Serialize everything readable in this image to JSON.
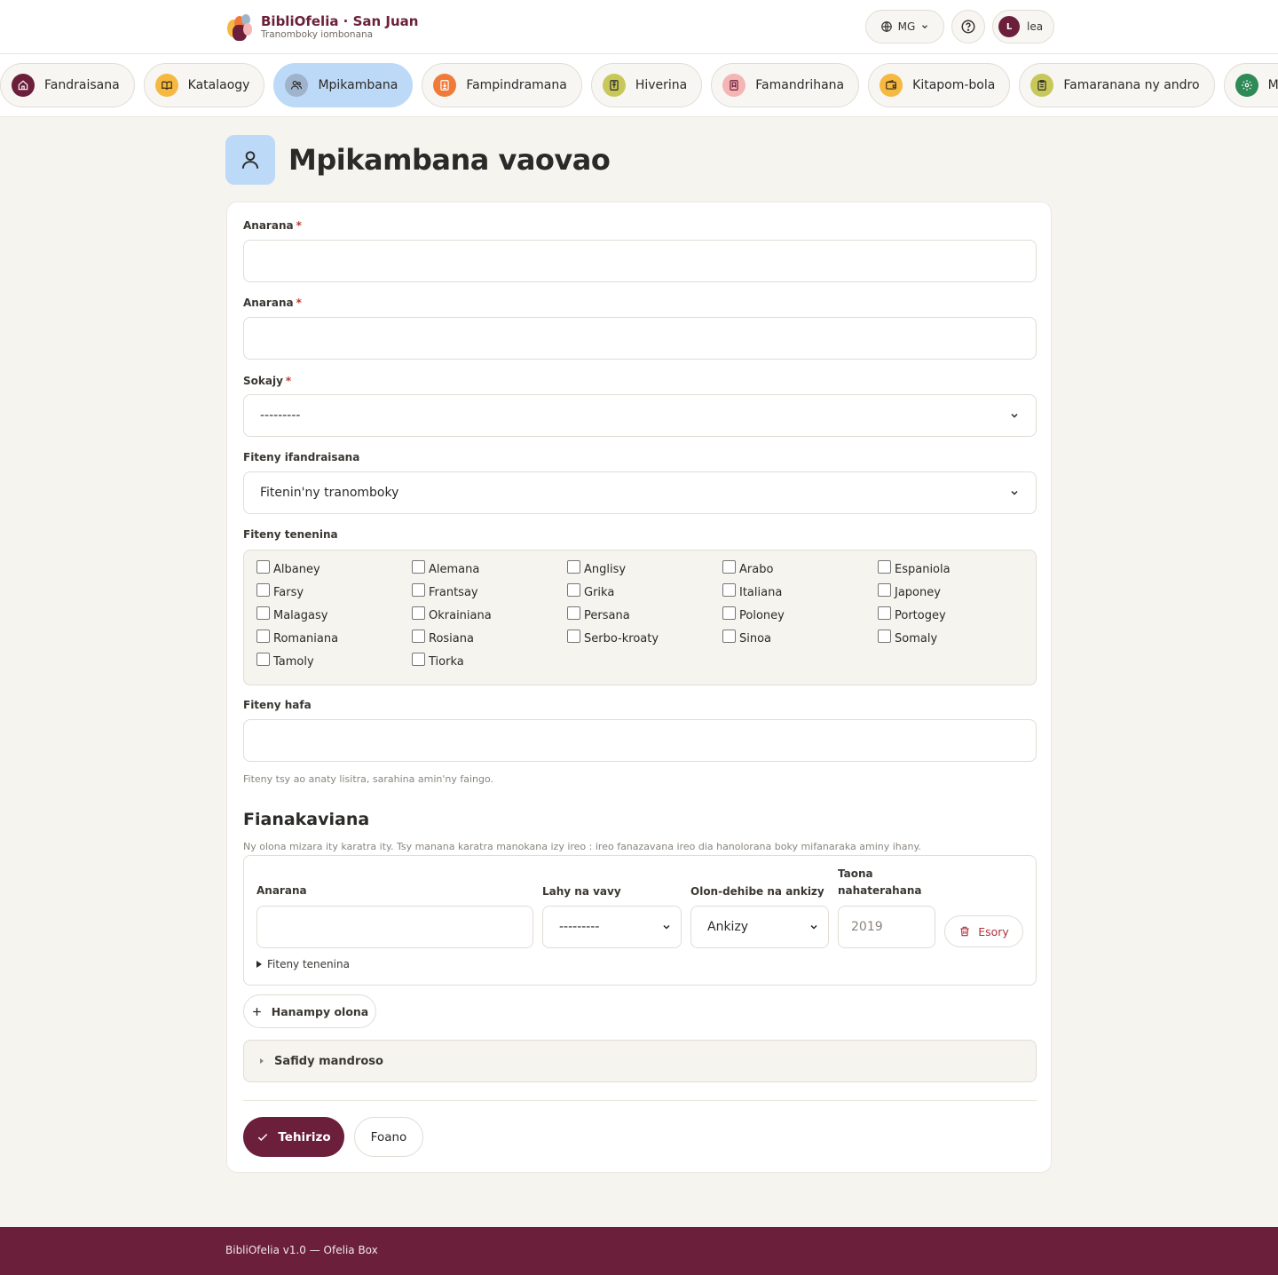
{
  "header": {
    "brand_title": "BibliOfelia · San Juan",
    "brand_subtitle": "Tranomboky iombonana",
    "language_code": "MG",
    "user_initial": "L",
    "user_name": "lea"
  },
  "nav": {
    "tabs": [
      {
        "label": "Fandraisana",
        "icon": "home-icon",
        "color": "#6b1f3a",
        "active": false
      },
      {
        "label": "Katalaogy",
        "icon": "book-open-icon",
        "color": "#f5b942",
        "active": false
      },
      {
        "label": "Mpikambana",
        "icon": "users-icon",
        "color": "#9fb4cc",
        "active": true
      },
      {
        "label": "Fampindramana",
        "icon": "loan-icon",
        "color": "#f07a3a",
        "active": false
      },
      {
        "label": "Hiverina",
        "icon": "return-icon",
        "color": "#c8c85a",
        "active": false
      },
      {
        "label": "Famandrihana",
        "icon": "bookmark-icon",
        "color": "#f4b5b5",
        "active": false
      },
      {
        "label": "Kitapom-bola",
        "icon": "wallet-icon",
        "color": "#f5b942",
        "active": false
      },
      {
        "label": "Famaranana ny andro",
        "icon": "clipboard-icon",
        "color": "#c8c85a",
        "active": false
      },
      {
        "label": "Mandroso",
        "icon": "gear-icon",
        "color": "#2e8a57",
        "active": false
      }
    ]
  },
  "page": {
    "title": "Mpikambana vaovao"
  },
  "form": {
    "first_name_label": "Anarana",
    "last_name_label": "Anarana",
    "category_label": "Sokajy",
    "category_value": "---------",
    "pref_lang_label": "Fiteny ifandraisana",
    "pref_lang_value": "Fitenin'ny tranomboky",
    "spoken_label": "Fiteny tenenina",
    "languages": [
      "Albaney",
      "Alemana",
      "Anglisy",
      "Arabo",
      "Espaniola",
      "Farsy",
      "Frantsay",
      "Grika",
      "Italiana",
      "Japoney",
      "Malagasy",
      "Okrainiana",
      "Persana",
      "Poloney",
      "Portogey",
      "Romaniana",
      "Rosiana",
      "Serbo-kroaty",
      "Sinoa",
      "Somaly",
      "Tamoly",
      "Tiorka"
    ],
    "other_lang_label": "Fiteny hafa",
    "other_lang_help": "Fiteny tsy ao anaty lisitra, sarahina amin'ny faingo.",
    "household_title": "Fianakaviana",
    "household_help": "Ny olona mizara ity karatra ity. Tsy manana karatra manokana izy ireo : ireo fanazavana ireo dia hanolorana boky mifanaraka aminy ihany.",
    "household": {
      "name_label": "Anarana",
      "gender_label": "Lahy na vavy",
      "gender_value": "---------",
      "age_label": "Olon-dehibe na ankizy",
      "age_value": "Ankizy",
      "birth_label": "Taona nahaterahana",
      "birth_placeholder": "2019",
      "delete_label": "Esory",
      "details_label": "Fiteny tenenina"
    },
    "add_row_label": "Hanampy olona",
    "advanced_label": "Safidy mandroso",
    "save_label": "Tehirizo",
    "cancel_label": "Foano"
  },
  "footer": {
    "text": "BibliOfelia v1.0 — Ofelia Box"
  }
}
